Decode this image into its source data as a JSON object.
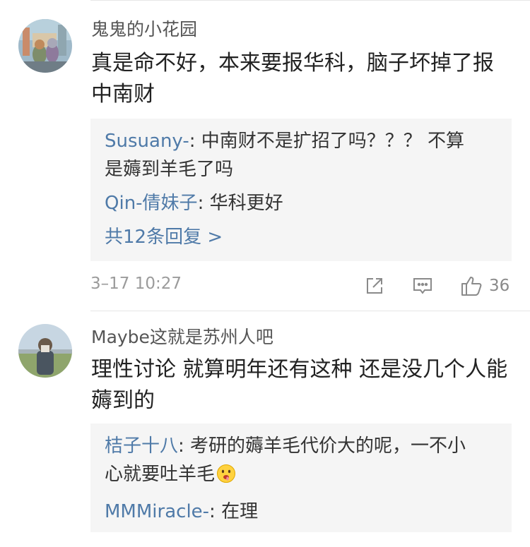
{
  "comments": [
    {
      "username": "鬼鬼的小花园",
      "content_line1": "真是命不好，本来要报华科，脑子坏掉了报",
      "content_line2": "中南财",
      "replies": [
        {
          "name": "Susuany-",
          "text_line1": ": 中南财不是扩招了吗？？？ 不算",
          "text_line2": "是薅到羊毛了吗"
        },
        {
          "name": "Qin-倩妹子",
          "text": ": 华科更好"
        }
      ],
      "more_replies": "共12条回复 >",
      "time": "3–17 10:27",
      "likes": "36"
    },
    {
      "username": "Maybe这就是苏州人吧",
      "content_line1": "理性讨论 就算明年还有这种 还是没几个人能",
      "content_line2": "薅到的",
      "replies": [
        {
          "name": "桔子十八",
          "text_line1": ": 考研的薅羊毛代价大的呢，一不小",
          "text_line2": "心就要吐羊毛"
        },
        {
          "name": "MMMiracle-",
          "text": ": 在理"
        }
      ]
    }
  ],
  "icons": {
    "share": "share-icon",
    "comment": "comment-icon",
    "like": "thumbs-up-icon",
    "emoji": "drooling-face-emoji"
  },
  "colors": {
    "link": "#4f7aa8",
    "reply_bg": "#f5f5f5",
    "meta": "#9b9b9b"
  }
}
